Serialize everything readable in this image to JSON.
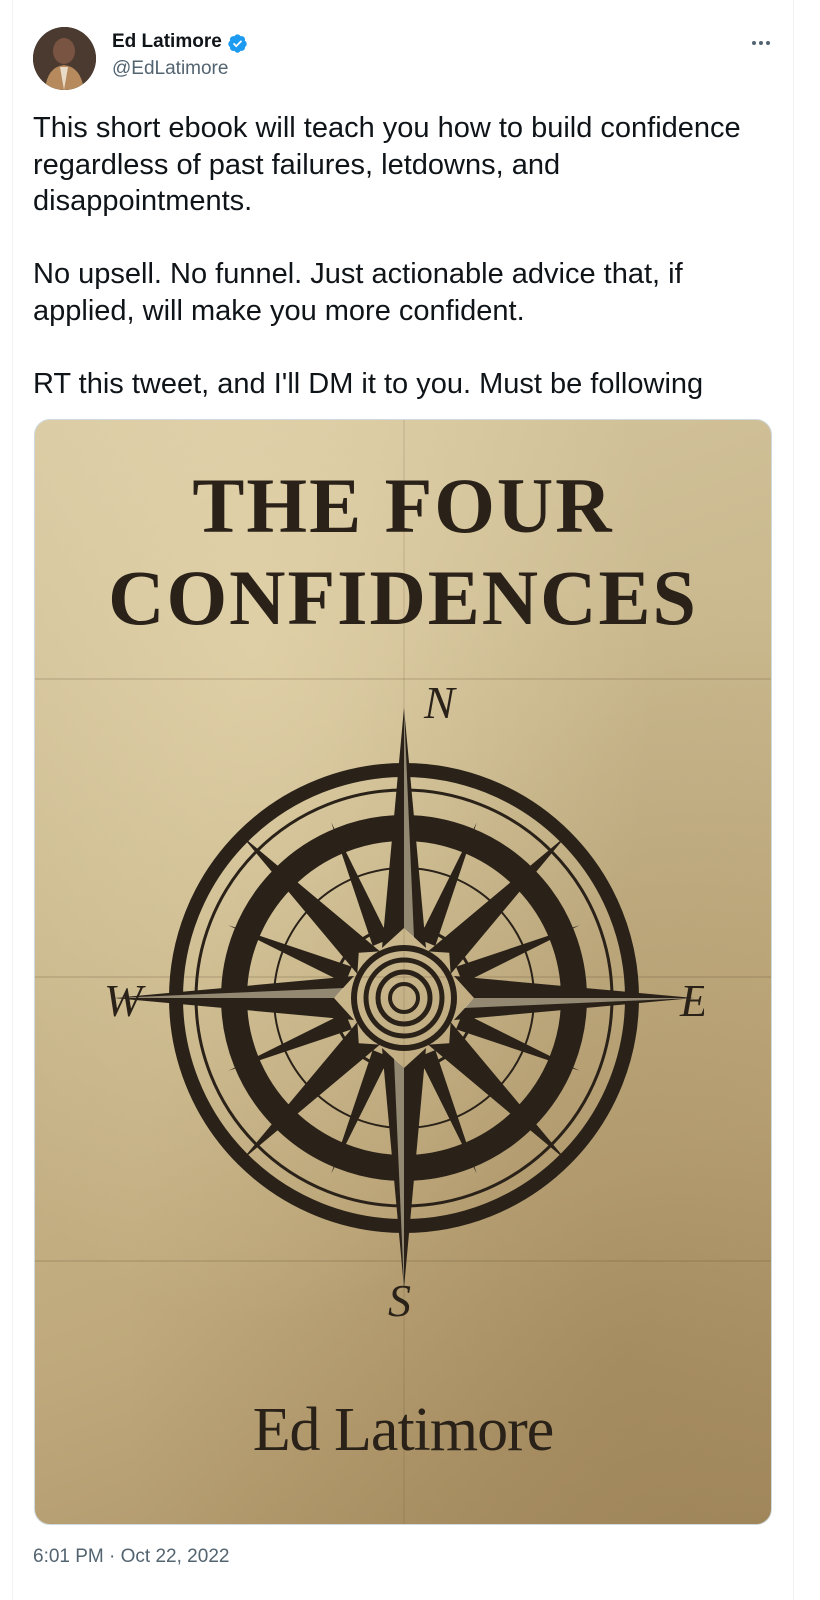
{
  "tweet": {
    "author": {
      "name": "Ed Latimore",
      "handle": "@EdLatimore",
      "verified": true,
      "verified_color": "#1d9bf0"
    },
    "text": [
      "This short ebook will teach you how to build confidence regardless of past failures, letdowns, and disappointments.",
      "No upsell. No funnel. Just actionable advice that, if applied, will make you more confident.",
      "RT this tweet, and I'll DM it to you. Must be following"
    ],
    "media": {
      "title_line1": "THE FOUR",
      "title_line2": "CONFIDENCES",
      "author": "Ed Latimore",
      "compass_labels": {
        "n": "N",
        "e": "E",
        "s": "S",
        "w": "W"
      }
    },
    "timestamp": {
      "time": "6:01 PM",
      "separator": " · ",
      "date": "Oct 22, 2022"
    },
    "icons": [
      "verified-badge-icon",
      "more-options-icon"
    ]
  }
}
